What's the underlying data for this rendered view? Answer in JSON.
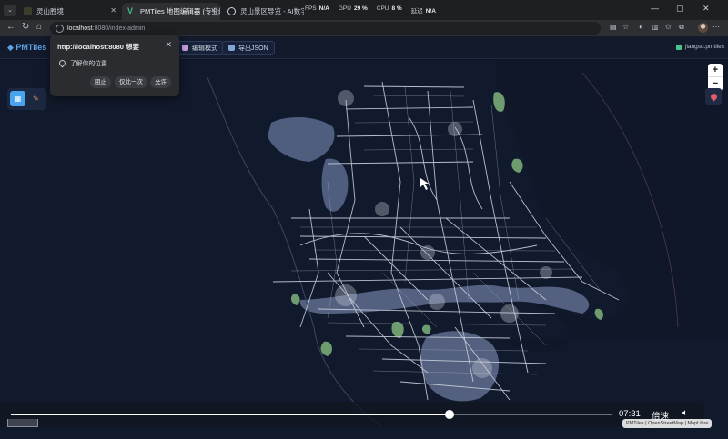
{
  "tabs": [
    {
      "title": "灵山胜境",
      "active": false
    },
    {
      "title": "PMTiles 地图编辑器 (专业编辑版)",
      "active": true
    },
    {
      "title": "灵山景区导览 - AI数字人导游",
      "active": false
    }
  ],
  "perf": {
    "fps_label": "FPS",
    "fps_value": "N/A",
    "gpu_label": "GPU",
    "gpu_value": "29 %",
    "cpu_label": "CPU",
    "cpu_value": "8 %",
    "latency_label": "延迟",
    "latency_value": "N/A"
  },
  "address": {
    "host": "localhost",
    "rest": ":8080/index-admin"
  },
  "app": {
    "logo": "PMTiles",
    "edit_mode": "编辑模式",
    "export_json": "导出JSON",
    "file_name": "jiangsu.pmtiles"
  },
  "permission": {
    "title": "http://localhost:8080 想要",
    "request": "了解你的位置",
    "block": "阻止",
    "allow_once": "仅此一次",
    "allow": "允许"
  },
  "zoom": {
    "in": "+",
    "out": "−"
  },
  "video": {
    "time": "07:31",
    "speed_label": "倍速",
    "progress": 0.73
  },
  "attribution": "PMTiles | OpenStreetMap | MapLibre",
  "colors": {
    "map_background": "#111a2c",
    "land": "#17213a",
    "water": "#53607f",
    "roads": "#c9cfdc",
    "green": "#6f9c6f",
    "accent": "#5ea3e6"
  }
}
